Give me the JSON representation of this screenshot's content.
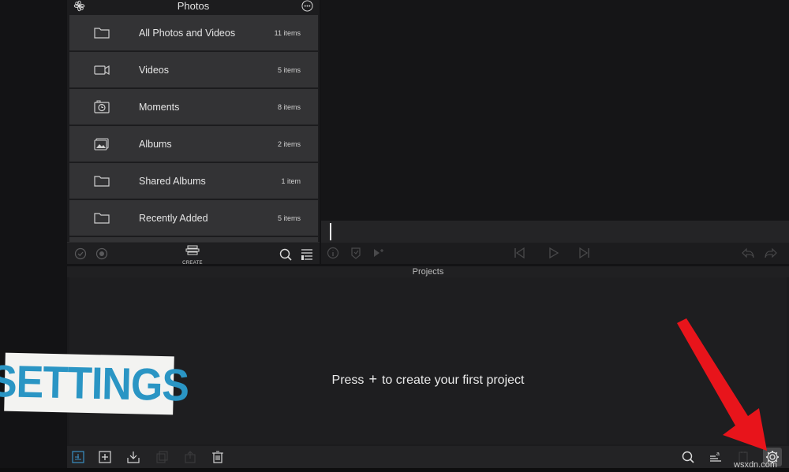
{
  "photos": {
    "title": "Photos",
    "items": [
      {
        "label": "All Photos and Videos",
        "count": "11 items",
        "icon": "folder-icon"
      },
      {
        "label": "Videos",
        "count": "5 items",
        "icon": "video-camera-icon"
      },
      {
        "label": "Moments",
        "count": "8 items",
        "icon": "moments-icon"
      },
      {
        "label": "Albums",
        "count": "2 items",
        "icon": "albums-icon"
      },
      {
        "label": "Shared Albums",
        "count": "1 item",
        "icon": "folder-icon"
      },
      {
        "label": "Recently Added",
        "count": "5 items",
        "icon": "folder-icon"
      }
    ],
    "toolbar": {
      "create_label": "CREATE"
    }
  },
  "projects": {
    "title": "Projects",
    "empty_before": "Press",
    "empty_plus": "+",
    "empty_after": "to create your first project"
  },
  "overlay": {
    "badge_text": "SETTINGS",
    "arrow_color": "#e8141b",
    "badge_color": "#2a95c4"
  },
  "watermark": "wsxdn.com",
  "colors": {
    "background": "#131315",
    "row": "#333335",
    "text": "#e6e6e6"
  }
}
